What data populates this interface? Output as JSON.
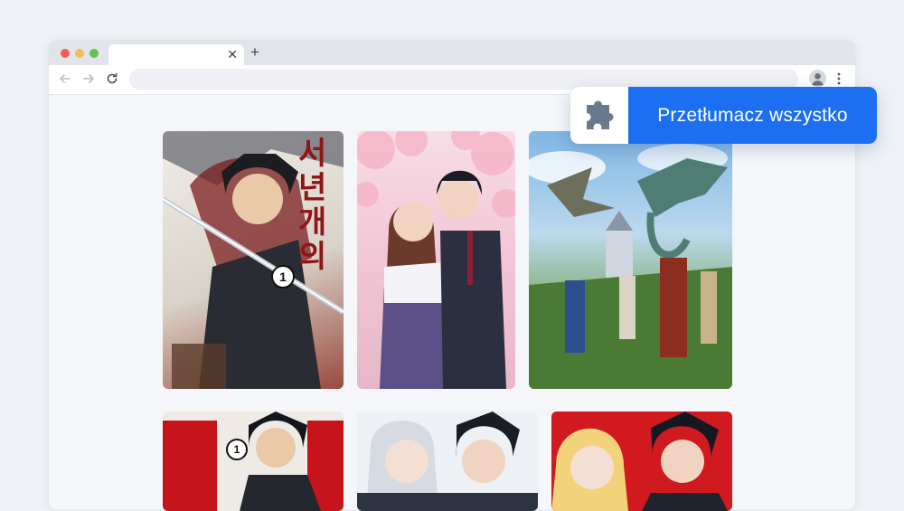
{
  "browser": {
    "tab_title": "",
    "tab_close_icon": "close-icon",
    "new_tab_symbol": "+",
    "address_url": "",
    "controls": [
      "back-arrow-icon",
      "forward-arrow-icon",
      "reload-icon",
      "profile-icon",
      "kebab-menu-icon"
    ]
  },
  "extension": {
    "icon": "puzzle-piece-icon",
    "button_label": "Przetłumacz wszystko",
    "accent_color": "#1d6ff2"
  },
  "manga_grid": {
    "covers": [
      {
        "id": "cover-1",
        "title_glyphs": "서년개의",
        "badge": "1"
      },
      {
        "id": "cover-2"
      },
      {
        "id": "cover-3"
      },
      {
        "id": "cover-4",
        "badge": "1"
      },
      {
        "id": "cover-5"
      },
      {
        "id": "cover-6"
      }
    ]
  }
}
